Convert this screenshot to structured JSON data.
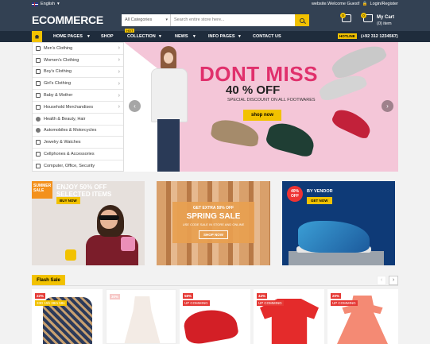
{
  "topbar": {
    "language": "English",
    "welcome": "website.Welcome Guest!",
    "login": "Login/Register"
  },
  "logo": "ECOMMERCE",
  "search": {
    "category": "All Categories",
    "placeholder": "Search entire store here..."
  },
  "cart": {
    "title": "My Cart",
    "items": "(0) item",
    "wish_count": "0",
    "cart_count": "0"
  },
  "nav": {
    "items": [
      "HOME PAGES",
      "SHOP",
      "COLLECTION",
      "NEWS",
      "INFO PAGES",
      "CONTACT US"
    ],
    "hot": "HOT",
    "hotline": "HOTLINE",
    "phone": "(+92 312 1234567)"
  },
  "categories": [
    "Men's Clothing",
    "Women's Clothing",
    "Boy's Clothing",
    "Girl's Clothing",
    "Baby & Mother",
    "Household Merchandises",
    "Health & Beauty, Hair",
    "Automobiles & Motorcycles",
    "Jewelry & Watches",
    "Cellphones & Accessories",
    "Computer, Office, Security"
  ],
  "hero": {
    "title": "DONT MISS",
    "off": "40 % OFF",
    "subtitle": "SPECIAL DISCOUNT ON ALL FOOTWARES",
    "button": "shop now"
  },
  "banner1": {
    "corner_line1": "SUMMER",
    "corner_line2": "SALE",
    "line1": "ENJOY 50% OFF",
    "line2": "SELECTED ITEMS",
    "button": "BUY NOW"
  },
  "banner2": {
    "line1": "GET EXTRA 50% OFF",
    "line2": "SPRING SALE",
    "line3": "USE CODE SALE IN STORE AND ONLINE",
    "button": "SHOP NOW"
  },
  "banner3": {
    "pct_line1": "40%",
    "pct_line2": "OFF",
    "vendor": "BY VENDOR",
    "button": "GET NOW"
  },
  "flash": {
    "title": "Flash Sale"
  },
  "products": [
    {
      "discount": "22%",
      "label": "33D 15h 38m 58s"
    },
    {
      "discount": "30%",
      "label": ""
    },
    {
      "discount": "58%",
      "label": "UP COMMING"
    },
    {
      "discount": "44%",
      "label": "UP COMMING"
    },
    {
      "discount": "20%",
      "label": "UP COMMING"
    }
  ]
}
